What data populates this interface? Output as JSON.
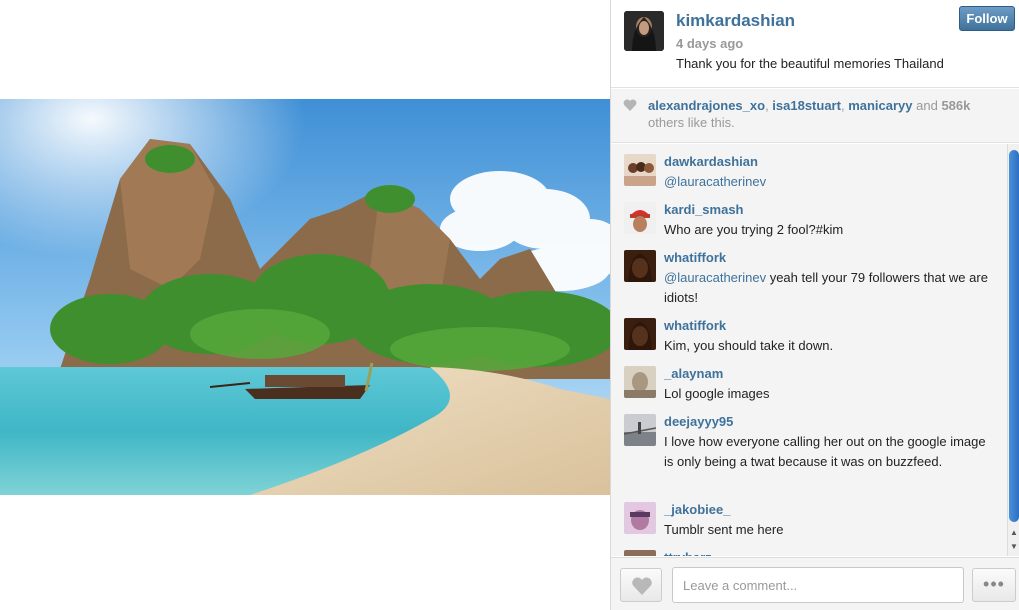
{
  "post": {
    "username": "kimkardashian",
    "time_ago": "4 days ago",
    "caption": "Thank you for the beautiful memories Thailand",
    "follow_label": "Follow"
  },
  "likes": {
    "likers": [
      "alexandrajones_xo",
      "isa18stuart",
      "manicaryy"
    ],
    "separator_1": ", ",
    "separator_2": ", ",
    "and_text": " and ",
    "count": "586k",
    "others_text": "others like this."
  },
  "comments": [
    {
      "user": "dawkardashian",
      "mention": "@lauracatherinev",
      "text": " ",
      "avatar_color": "#c9a48a"
    },
    {
      "user": "kardi_smash",
      "mention": "",
      "text": "Who are you trying 2 fool?#kim",
      "avatar_color": "#c0392b"
    },
    {
      "user": "whatiffork",
      "mention": "@lauracatherinev",
      "text": " yeah tell your 79 followers that we are idiots!",
      "avatar_color": "#7a3b1e"
    },
    {
      "user": "whatiffork",
      "mention": "",
      "text": "Kim, you should take it down.",
      "avatar_color": "#7a3b1e"
    },
    {
      "user": "_alaynam",
      "mention": "",
      "text": "Lol google images",
      "avatar_color": "#a89880"
    },
    {
      "user": "deejayyy95",
      "mention": "",
      "text": "I love how everyone calling her out on the google image is only being a twat because it was on buzzfeed.",
      "avatar_color": "#9aa0a6"
    },
    {
      "user": "_jakobiee_",
      "mention": "",
      "text": "Tumblr sent me here",
      "avatar_color": "#b07aa1"
    },
    {
      "user": "ttrybarz",
      "mention": "",
      "text": "",
      "avatar_color": "#8a6d5a"
    }
  ],
  "footer": {
    "comment_placeholder": "Leave a comment...",
    "more_label": "•••"
  },
  "colors": {
    "link_blue": "#3f729b",
    "muted_gray": "#999999",
    "panel_bg": "#f4f4f4"
  },
  "icons": {
    "like": "heart-icon",
    "more": "ellipsis-icon"
  }
}
